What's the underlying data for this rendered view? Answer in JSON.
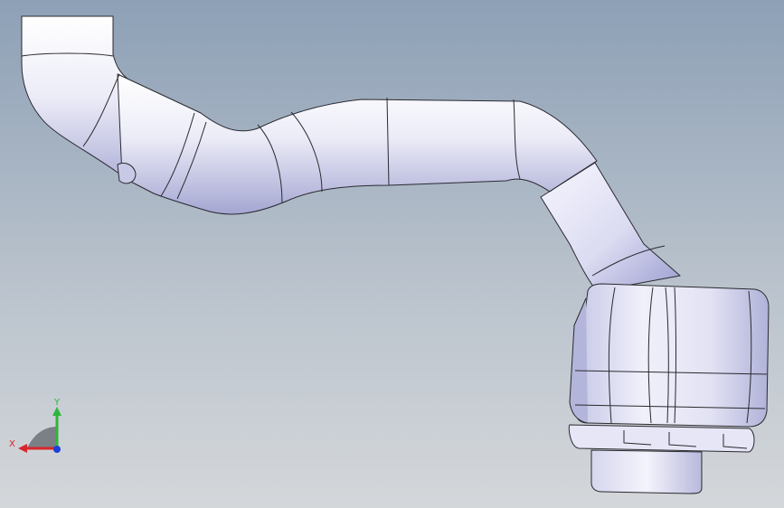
{
  "viewport": {
    "background_top": "#8da0b6",
    "background_bottom": "#d4d7da",
    "part_fill": "#e9e9f6",
    "part_shade": "#a7a8d0",
    "edge_color": "#2a2a30"
  },
  "triad": {
    "x_label": "X",
    "y_label": "Y",
    "x_color": "#d8262a",
    "y_color": "#2eb63c",
    "z_color": "#1e3fd8"
  }
}
